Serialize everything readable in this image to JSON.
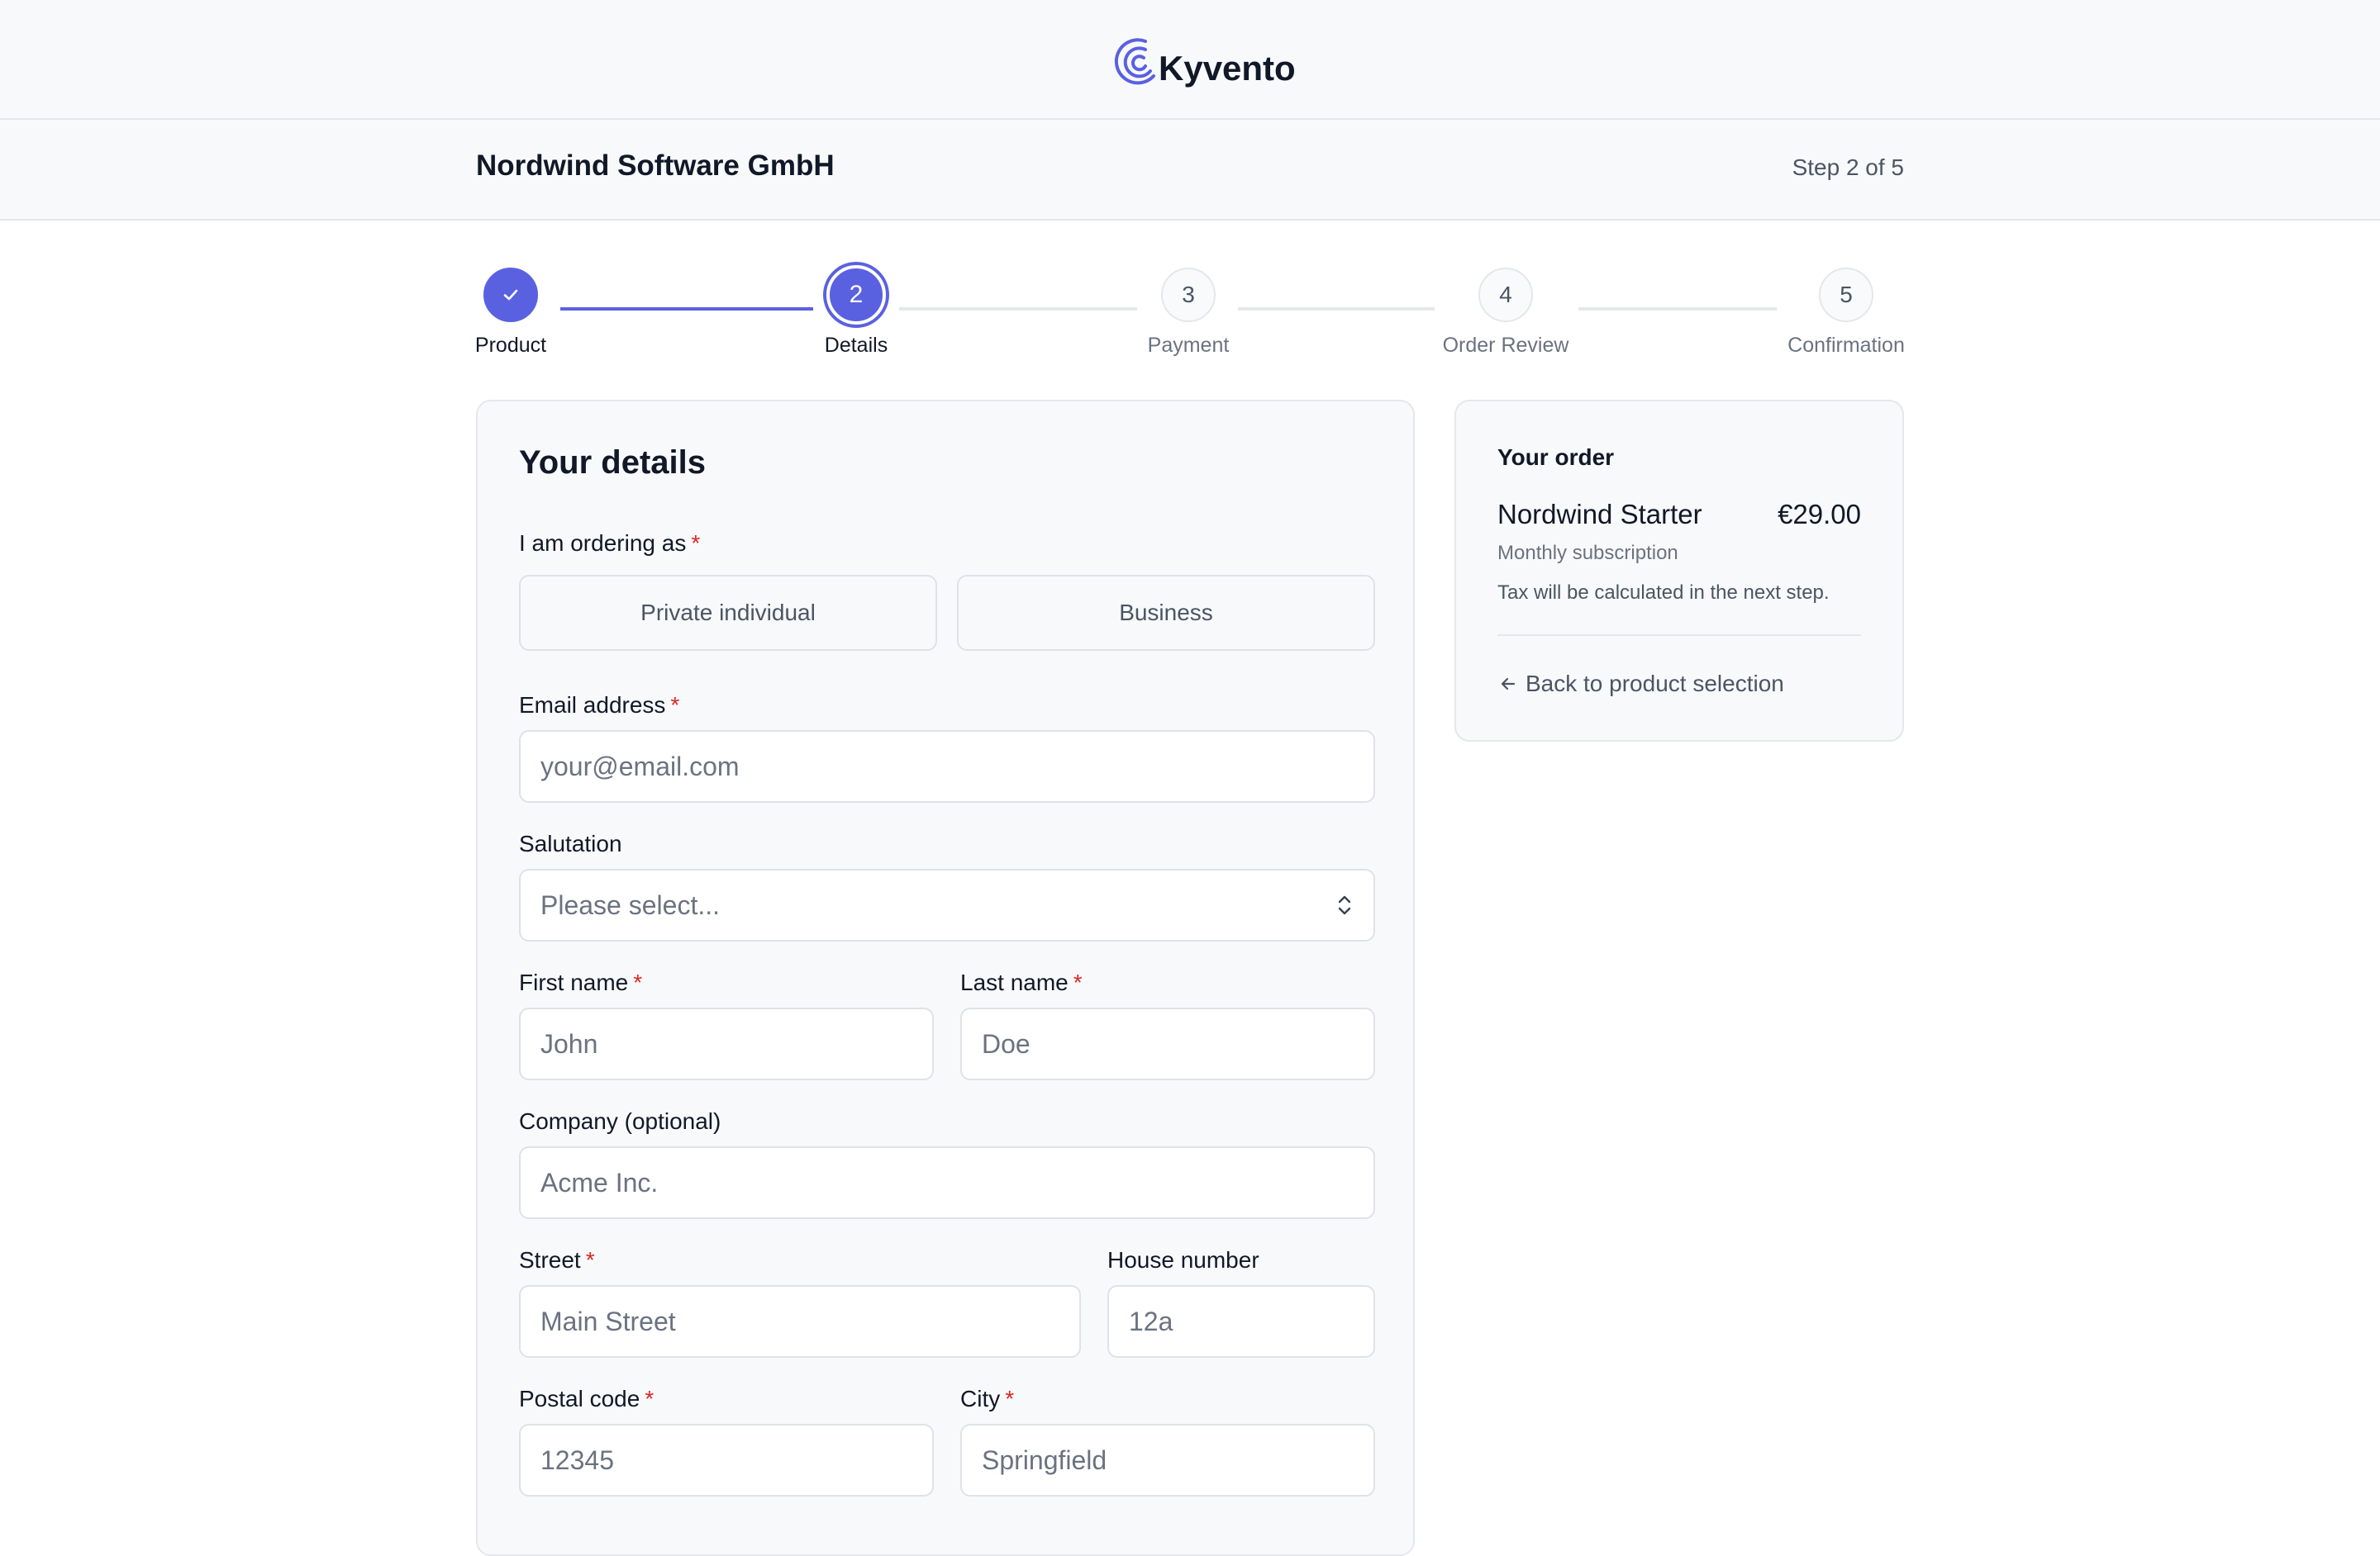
{
  "brand": {
    "name": "Kyvento",
    "accent": "#5a61e0"
  },
  "header": {
    "company": "Nordwind Software GmbH",
    "step_count": "Step 2 of 5"
  },
  "stepper": {
    "steps": [
      {
        "number": "1",
        "label": "Product",
        "state": "done"
      },
      {
        "number": "2",
        "label": "Details",
        "state": "active"
      },
      {
        "number": "3",
        "label": "Payment",
        "state": "pending"
      },
      {
        "number": "4",
        "label": "Order Review",
        "state": "pending"
      },
      {
        "number": "5",
        "label": "Confirmation",
        "state": "pending"
      }
    ]
  },
  "form": {
    "title": "Your details",
    "ordering_as": {
      "label": "I am ordering as",
      "required": "*",
      "options": [
        "Private individual",
        "Business"
      ]
    },
    "email": {
      "label": "Email address",
      "required": "*",
      "placeholder": "your@email.com"
    },
    "salutation": {
      "label": "Salutation",
      "placeholder": "Please select..."
    },
    "first_name": {
      "label": "First name",
      "required": "*",
      "placeholder": "John"
    },
    "last_name": {
      "label": "Last name",
      "required": "*",
      "placeholder": "Doe"
    },
    "company": {
      "label": "Company (optional)",
      "placeholder": "Acme Inc."
    },
    "street": {
      "label": "Street",
      "required": "*",
      "placeholder": "Main Street"
    },
    "house_number": {
      "label": "House number",
      "placeholder": "12a"
    },
    "postal_code": {
      "label": "Postal code",
      "required": "*",
      "placeholder": "12345"
    },
    "city": {
      "label": "City",
      "required": "*",
      "placeholder": "Springfield"
    }
  },
  "order": {
    "heading": "Your order",
    "product": "Nordwind Starter",
    "price": "€29.00",
    "billing": "Monthly subscription",
    "tax_note": "Tax will be calculated in the next step.",
    "back_link": "Back to product selection"
  },
  "icons": {
    "check": "check-icon",
    "chevron": "chevron-updown-icon",
    "arrow": "arrow-left-icon"
  }
}
